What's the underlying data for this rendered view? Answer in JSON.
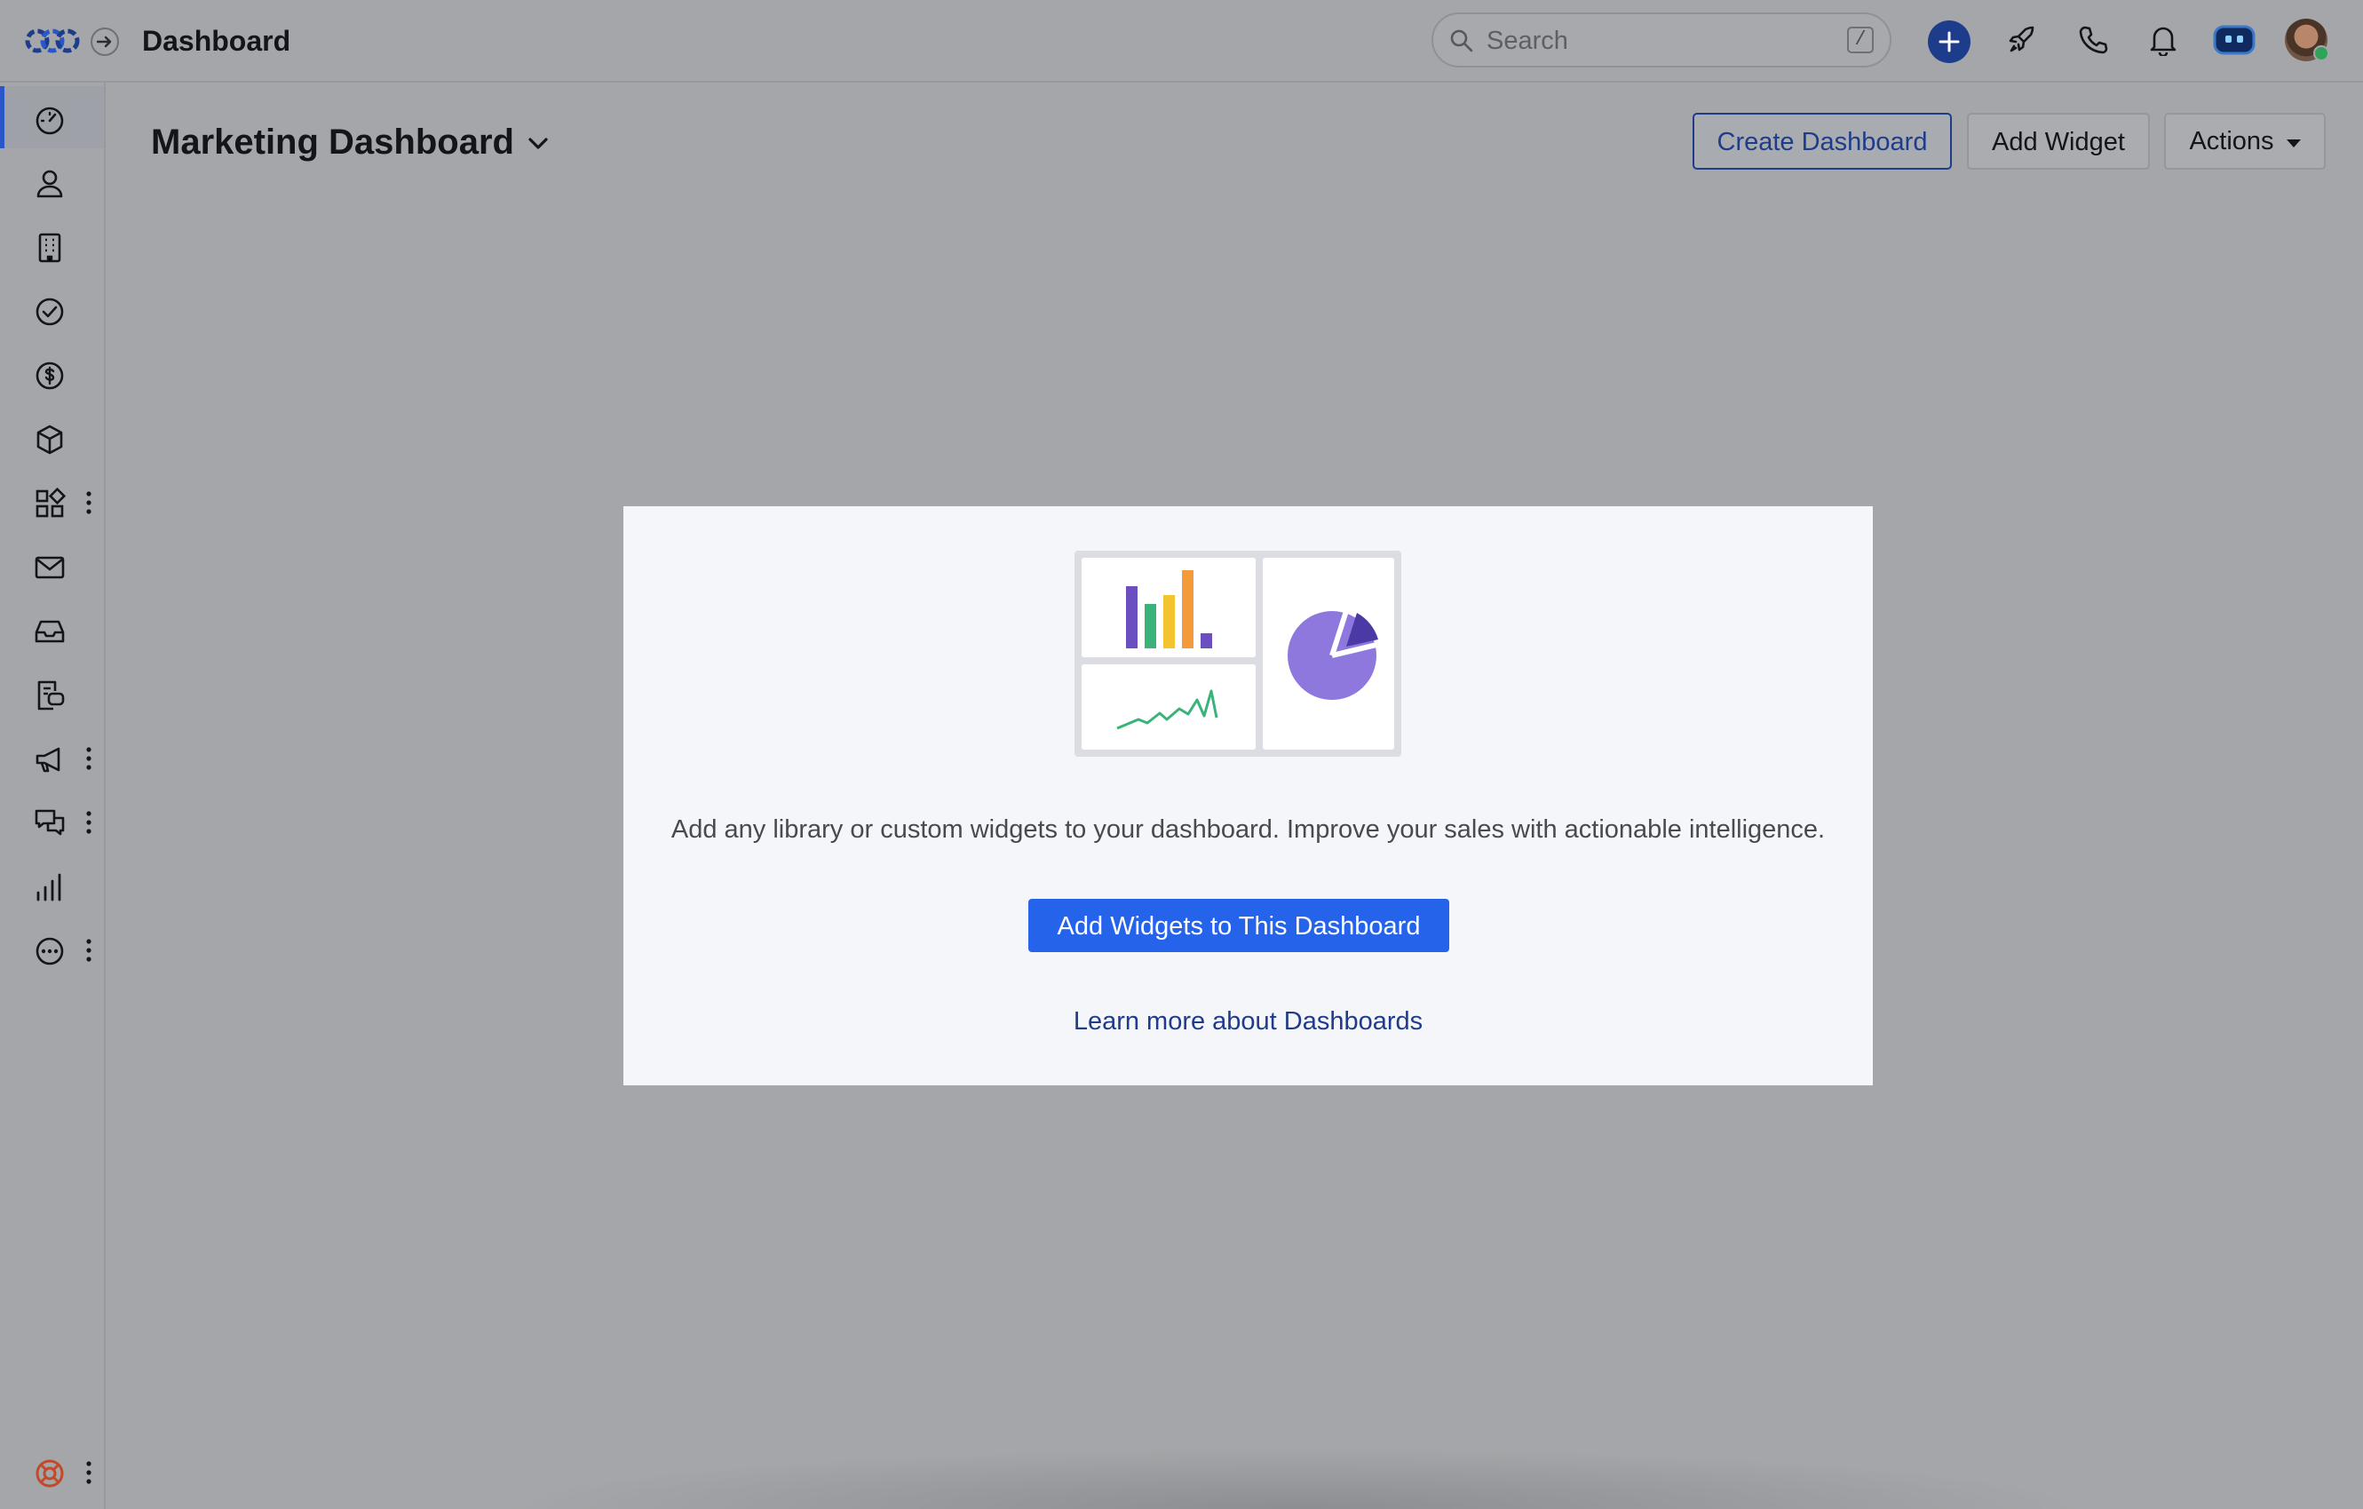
{
  "header": {
    "app_title": "Dashboard",
    "search_placeholder": "Search",
    "search_shortcut": "/",
    "icons": [
      "crm-logo",
      "expand-arrow-icon",
      "search-icon",
      "plus-icon",
      "rocket-icon",
      "phone-icon",
      "bell-icon",
      "assistant-icon",
      "user-avatar"
    ]
  },
  "sidebar": {
    "items": [
      {
        "name": "dashboard",
        "icon": "speedometer-icon",
        "active": true
      },
      {
        "name": "contacts",
        "icon": "person-icon"
      },
      {
        "name": "accounts",
        "icon": "building-icon"
      },
      {
        "name": "tasks",
        "icon": "check-circle-icon"
      },
      {
        "name": "deals",
        "icon": "dollar-circle-icon"
      },
      {
        "name": "products",
        "icon": "cube-icon"
      },
      {
        "name": "apps",
        "icon": "apps-grid-icon",
        "more": true
      },
      {
        "name": "email",
        "icon": "mail-icon"
      },
      {
        "name": "inbox",
        "icon": "inbox-tray-icon"
      },
      {
        "name": "documents",
        "icon": "document-chat-icon"
      },
      {
        "name": "campaigns",
        "icon": "megaphone-icon",
        "more": true
      },
      {
        "name": "conversations",
        "icon": "chat-bubbles-icon",
        "more": true
      },
      {
        "name": "reports",
        "icon": "bar-chart-icon"
      },
      {
        "name": "more",
        "icon": "ellipsis-circle-icon",
        "more": true
      }
    ],
    "help_icon": "lifebuoy-icon"
  },
  "page": {
    "title": "Marketing Dashboard",
    "buttons": {
      "create": "Create Dashboard",
      "add_widget": "Add Widget",
      "actions": "Actions"
    }
  },
  "empty_state": {
    "message": "Add any library or custom widgets to your dashboard. Improve your sales with actionable intelligence.",
    "cta_label": "Add Widgets to This Dashboard",
    "learn_more": "Learn more about Dashboards",
    "illustration_colors": {
      "purple": "#6b4fc0",
      "green": "#3ab37a",
      "yellow": "#f4c430",
      "orange": "#f59a3a",
      "pie": "#8e78dd",
      "pie_slice": "#4b3aa6"
    }
  },
  "colors": {
    "overlay": "#a4a6a9",
    "primary": "#2563eb",
    "brand_navy": "#1f3c8a",
    "active_indicator": "#2a57c7"
  }
}
